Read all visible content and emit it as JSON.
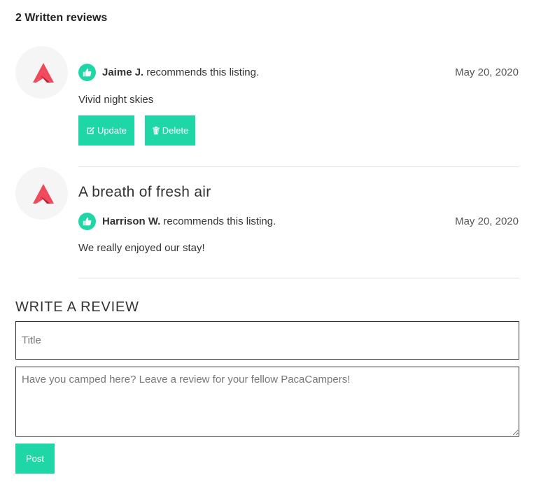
{
  "reviews_heading": "2 Written reviews",
  "colors": {
    "accent": "#1fd6a6",
    "logo_red": "#f0485a",
    "logo_dark": "#b8202f"
  },
  "icons": {
    "thumb": "thumbs-up-icon",
    "avatar": "pacacamp-logo-icon",
    "update": "edit-icon",
    "delete": "trash-icon"
  },
  "reviews": [
    {
      "title": "",
      "name": "Jaime J.",
      "recommends_text": "recommends this listing.",
      "date": "May 20, 2020",
      "body": "Vivid night skies",
      "update_label": "Update",
      "delete_label": "Delete"
    },
    {
      "title": "A breath of fresh air",
      "name": "Harrison W.",
      "recommends_text": "recommends this listing.",
      "date": "May 20, 2020",
      "body": "We really enjoyed our stay!"
    }
  ],
  "write_review": {
    "heading": "WRITE A REVIEW",
    "title_placeholder": "Title",
    "body_placeholder": "Have you camped here? Leave a review for your fellow PacaCampers!",
    "post_label": "Post"
  }
}
